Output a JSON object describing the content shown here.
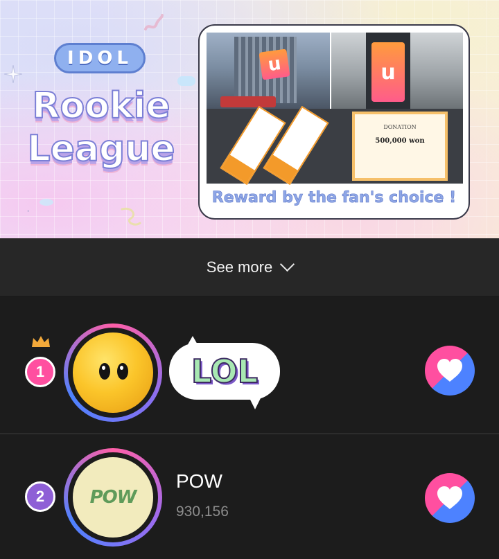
{
  "banner": {
    "pill_text": "IDOL",
    "title_line1": "Rookie",
    "title_line2": "League",
    "sign_letter": "u",
    "certificate_title": "DONATION",
    "certificate_amount": "500,000 won",
    "reward_text": "Reward by the fan's choice !"
  },
  "see_more": {
    "label": "See more"
  },
  "ranking": [
    {
      "rank": "1",
      "name_logo": "LOL",
      "badge_color": "#ff4fa0",
      "ring_color": "#6b5ad8",
      "has_crown": true
    },
    {
      "rank": "2",
      "name": "POW",
      "logo_text": "POW",
      "votes": "930,156",
      "badge_color": "#8e5fd6",
      "ring_color": "#7c5fd8"
    }
  ],
  "colors": {
    "vote_pink": "#ff4fa0",
    "vote_blue": "#4d82ff",
    "crown": "#f3a93a"
  },
  "icons": {
    "see_more": "chevron-down-icon",
    "vote": "heart-icon",
    "rank1": "crown-icon"
  }
}
